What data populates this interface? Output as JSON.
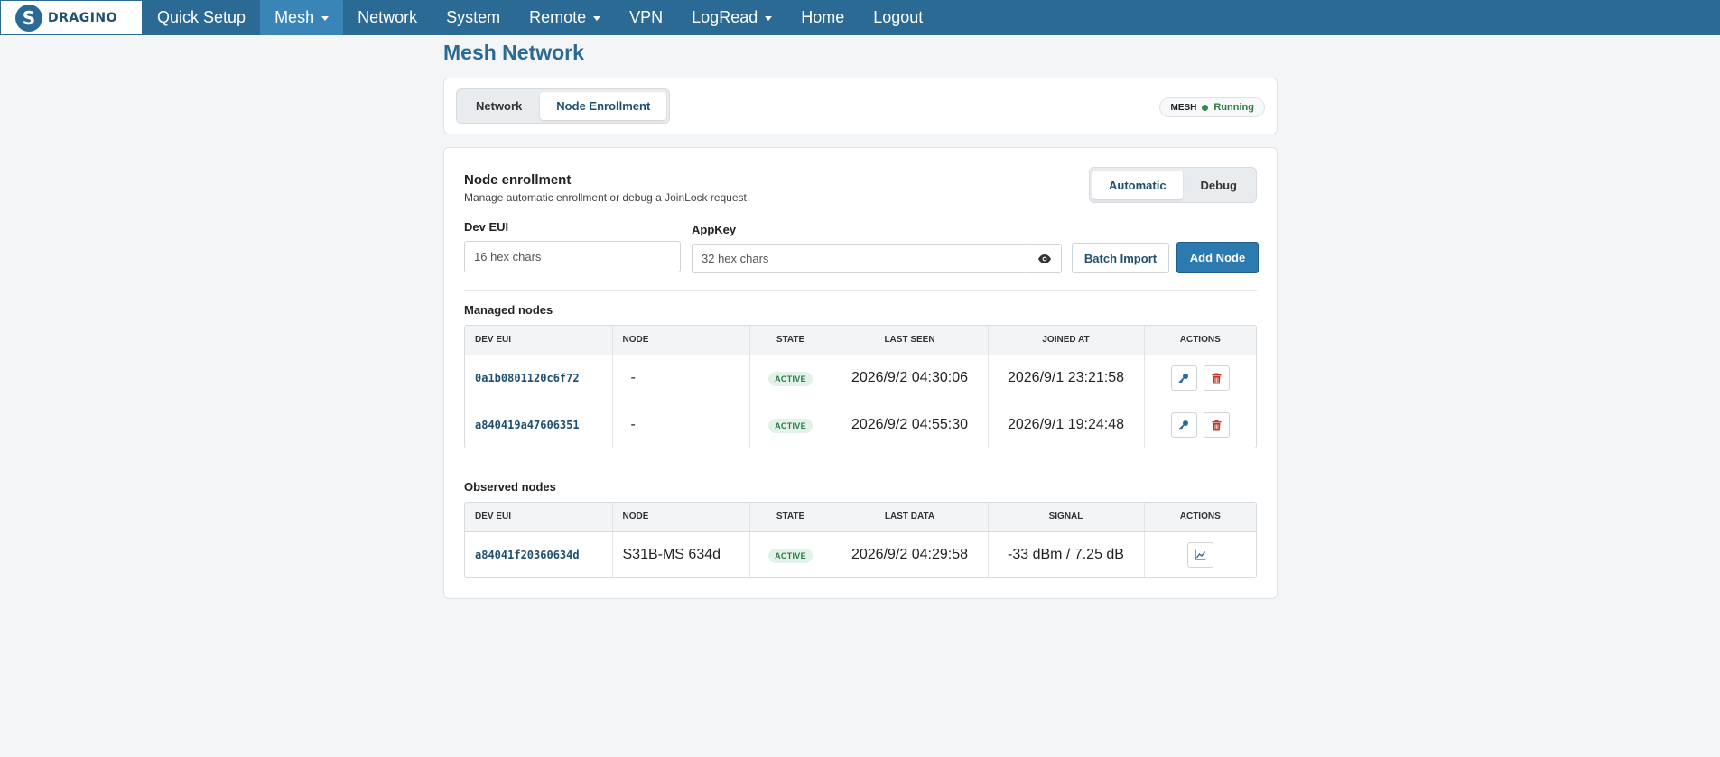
{
  "brand": {
    "logo_text": "DRAGINO"
  },
  "nav": [
    {
      "label": "Quick Setup",
      "dropdown": false,
      "active": false
    },
    {
      "label": "Mesh",
      "dropdown": true,
      "active": true
    },
    {
      "label": "Network",
      "dropdown": false,
      "active": false
    },
    {
      "label": "System",
      "dropdown": false,
      "active": false
    },
    {
      "label": "Remote",
      "dropdown": true,
      "active": false
    },
    {
      "label": "VPN",
      "dropdown": false,
      "active": false
    },
    {
      "label": "LogRead",
      "dropdown": true,
      "active": false
    },
    {
      "label": "Home",
      "dropdown": false,
      "active": false
    },
    {
      "label": "Logout",
      "dropdown": false,
      "active": false
    }
  ],
  "page": {
    "title": "Mesh Network"
  },
  "tabs": {
    "network": "Network",
    "node_enrollment": "Node Enrollment"
  },
  "status": {
    "label": "MESH",
    "value": "Running",
    "color": "#2f8a4c"
  },
  "enroll": {
    "title": "Node enrollment",
    "subtitle": "Manage automatic enrollment or debug a JoinLock request.",
    "mode_automatic": "Automatic",
    "mode_debug": "Debug",
    "deveui_label": "Dev EUI",
    "deveui_placeholder": "16 hex chars",
    "appkey_label": "AppKey",
    "appkey_placeholder": "32 hex chars",
    "batch_import": "Batch Import",
    "add_node": "Add Node"
  },
  "managed": {
    "title": "Managed nodes",
    "headers": [
      "DEV EUI",
      "NODE",
      "STATE",
      "LAST SEEN",
      "JOINED AT",
      "ACTIONS"
    ],
    "rows": [
      {
        "dev_eui": "0a1b0801120c6f72",
        "node": "-",
        "state": "ACTIVE",
        "last_seen": "2026/9/2 04:30:06",
        "joined_at": "2026/9/1 23:21:58"
      },
      {
        "dev_eui": "a840419a47606351",
        "node": "-",
        "state": "ACTIVE",
        "last_seen": "2026/9/2 04:55:30",
        "joined_at": "2026/9/1 19:24:48"
      }
    ]
  },
  "observed": {
    "title": "Observed nodes",
    "headers": [
      "DEV EUI",
      "NODE",
      "STATE",
      "LAST DATA",
      "SIGNAL",
      "ACTIONS"
    ],
    "rows": [
      {
        "dev_eui": "a84041f20360634d",
        "node": "S31B-MS 634d",
        "state": "ACTIVE",
        "last_data": "2026/9/2 04:29:58",
        "signal": "-33 dBm / 7.25 dB"
      }
    ]
  },
  "colors": {
    "brand": "#2b6a94",
    "primary": "#2b7bb0",
    "danger": "#c0392b",
    "success": "#2a7a44"
  }
}
